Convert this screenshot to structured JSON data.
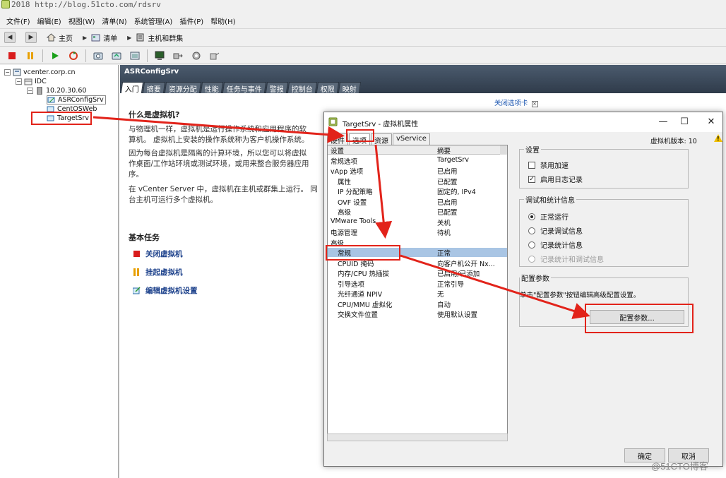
{
  "watermark": "2018 http://blog.51cto.com/rdsrv",
  "menu": [
    "文件(F)",
    "编辑(E)",
    "视图(W)",
    "清单(N)",
    "系统管理(A)",
    "插件(P)",
    "帮助(H)"
  ],
  "breadcrumb": [
    "主页",
    "清单",
    "主机和群集"
  ],
  "tree": {
    "root": "vcenter.corp.cn",
    "datacenter": "IDC",
    "host": "10.20.30.60",
    "vms": [
      "ASRConfigSrv",
      "CentOSWeb",
      "TargetSrv"
    ]
  },
  "main": {
    "object_title": "ASRConfigSrv",
    "tabs": [
      "入门",
      "摘要",
      "资源分配",
      "性能",
      "任务与事件",
      "警报",
      "控制台",
      "权限",
      "映射"
    ],
    "close_tab": "关闭选项卡",
    "heading": "什么是虚拟机?",
    "para1_line1": "与物理机一样，虚拟机是运行操作系统和应用程序的软",
    "para1_line2": "算机。 虚拟机上安装的操作系统称为客户机操作系统。",
    "para2_line1": "因为每台虚拟机是隔离的计算环境，所以您可以将虚拟",
    "para2_line2": "作桌面/工作站环境或测试环境，或用来整合服务器应用",
    "para2_line3": "序。",
    "para3_line1": "在 vCenter Server 中，虚拟机在主机或群集上运行。 同",
    "para3_line2": "台主机可运行多个虚拟机。",
    "basic_tasks": "基本任务",
    "tasks": [
      "关闭虚拟机",
      "挂起虚拟机",
      "编辑虚拟机设置"
    ]
  },
  "dialog": {
    "title": "TargetSrv - 虚拟机属性",
    "tabs": [
      "硬件",
      "选项",
      "资源",
      "vService"
    ],
    "vm_version": "虚拟机版本: 10",
    "list_headers": [
      "设置",
      "摘要"
    ],
    "rows": [
      {
        "name": "常规选项",
        "value": "TargetSrv"
      },
      {
        "name": "vApp 选项",
        "value": "已启用"
      },
      {
        "name": "属性",
        "value": "已配置"
      },
      {
        "name": "IP 分配策略",
        "value": "固定的, IPv4"
      },
      {
        "name": "OVF 设置",
        "value": "已启用"
      },
      {
        "name": "高级",
        "value": "已配置"
      },
      {
        "name": "VMware Tools",
        "value": "关机"
      },
      {
        "name": "电源管理",
        "value": "待机"
      },
      {
        "name": "高级",
        "value": ""
      },
      {
        "name": "常规",
        "value": "正常"
      },
      {
        "name": "CPUID 掩码",
        "value": "向客户机公开 Nx..."
      },
      {
        "name": "内存/CPU 热插拔",
        "value": "已启用/已添加"
      },
      {
        "name": "引导选项",
        "value": "正常引导"
      },
      {
        "name": "光纤通道 NPIV",
        "value": "无"
      },
      {
        "name": "CPU/MMU 虚拟化",
        "value": "自动"
      },
      {
        "name": "交换文件位置",
        "value": "使用默认设置"
      }
    ],
    "settings_group": "设置",
    "disable_accel": "禁用加速",
    "enable_logging": "启用日志记录",
    "debug_group": "调试和统计信息",
    "radio": [
      "正常运行",
      "记录调试信息",
      "记录统计信息",
      "记录统计和调试信息"
    ],
    "config_group": "配置参数",
    "config_desc": "单击\"配置参数\"按钮编辑高级配置设置。",
    "config_button": "配置参数...",
    "ok": "确定",
    "cancel": "取消"
  },
  "brand": "@51CTO博客",
  "colors": {
    "annotation": "#e2231a",
    "header": "#3a4656",
    "selection": "#a9c5e4"
  }
}
